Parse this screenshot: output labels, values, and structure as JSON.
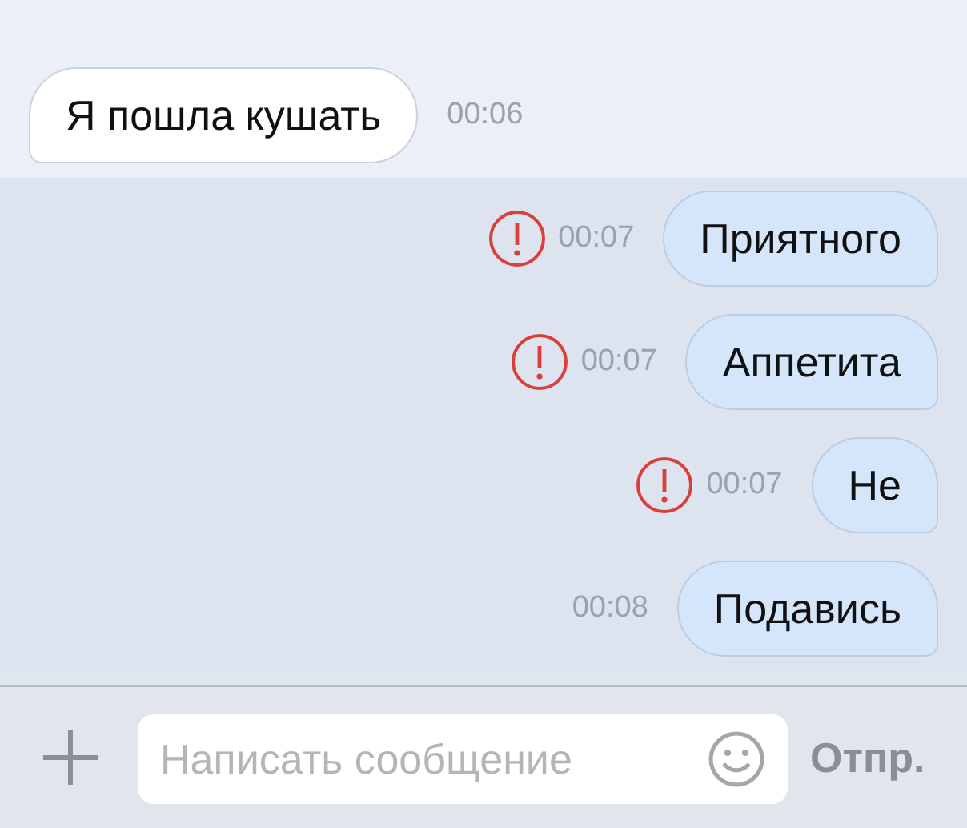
{
  "messages": [
    {
      "kind": "incoming",
      "text": "Я пошла кушать",
      "time": "00:06",
      "failed": false,
      "unread": false
    },
    {
      "kind": "outgoing",
      "text": "Приятного",
      "time": "00:07",
      "failed": true,
      "unread": true
    },
    {
      "kind": "outgoing",
      "text": "Аппетита",
      "time": "00:07",
      "failed": true,
      "unread": true
    },
    {
      "kind": "outgoing",
      "text": "Не",
      "time": "00:07",
      "failed": true,
      "unread": true
    },
    {
      "kind": "outgoing",
      "text": "Подавись",
      "time": "00:08",
      "failed": false,
      "unread": true
    }
  ],
  "composer": {
    "placeholder": "Написать сообщение",
    "send": "Отпр."
  }
}
